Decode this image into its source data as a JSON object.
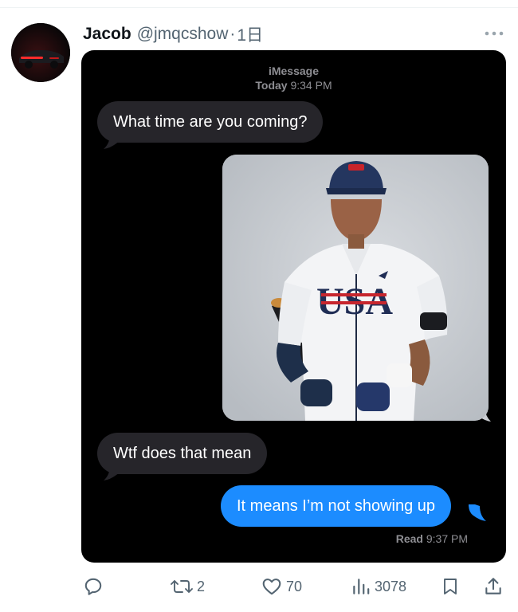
{
  "tweet": {
    "author_name": "Jacob",
    "handle": "@jmqcshow",
    "separator": "·",
    "time": "1日"
  },
  "imessage": {
    "service": "iMessage",
    "day": "Today",
    "time": "9:34 PM",
    "messages": [
      {
        "direction": "incoming",
        "text": "What time are you coming?"
      },
      {
        "direction": "outgoing",
        "type": "image",
        "image_icon": "baseball-player-photo",
        "jersey_text": "USA"
      },
      {
        "direction": "incoming",
        "text": "Wtf does that mean"
      },
      {
        "direction": "outgoing",
        "text": "It means I’m not showing up"
      }
    ],
    "read_label": "Read",
    "read_time": "9:37 PM"
  },
  "actions": {
    "reply_icon": "reply-icon",
    "retweet_count": "2",
    "like_count": "70",
    "views_count": "3078",
    "bookmark_icon": "bookmark-icon",
    "share_icon": "share-icon"
  },
  "colors": {
    "incoming_bubble": "#26252a",
    "outgoing_bubble": "#1c8cff",
    "meta_text": "#536471",
    "imessage_meta": "#8e8e93"
  }
}
